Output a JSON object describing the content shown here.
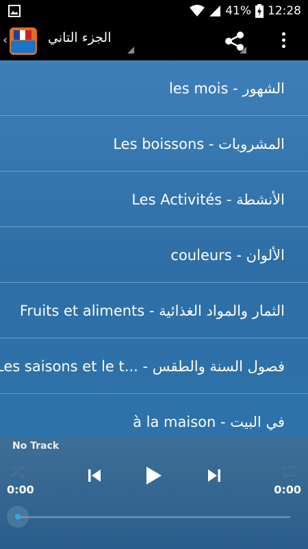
{
  "status_bar": {
    "battery_percent": "41%",
    "time": "12:28",
    "icons": [
      "image-icon",
      "wifi-icon",
      "signal-icon",
      "battery-charging-icon"
    ]
  },
  "action_bar": {
    "title": "الجزء التاني",
    "icons": [
      "back-chevron-icon",
      "app-logo-icon",
      "share-icon",
      "overflow-menu-icon"
    ]
  },
  "list": {
    "items": [
      {
        "label": "الشهور - les mois"
      },
      {
        "label": "المشروبات - Les boissons"
      },
      {
        "label": "الأنشطة - Les Activités"
      },
      {
        "label": "الألوان - couleurs"
      },
      {
        "label": "الثمار والمواد الغذائية - Fruits et aliments"
      },
      {
        "label": "فصول السنة والطقس - ...Les saisons et le t"
      },
      {
        "label": "في البيت - à la maison"
      }
    ]
  },
  "player": {
    "track_name": "No Track",
    "elapsed": "0:00",
    "duration": "0:00",
    "progress": 0,
    "icons": [
      "shuffle-icon",
      "previous-icon",
      "play-icon",
      "next-icon",
      "repeat-icon"
    ]
  },
  "colors": {
    "list_bg": "#2e6ea6",
    "player_bg": "#2a5d8a",
    "seek_thumb": "#39a8e6"
  }
}
